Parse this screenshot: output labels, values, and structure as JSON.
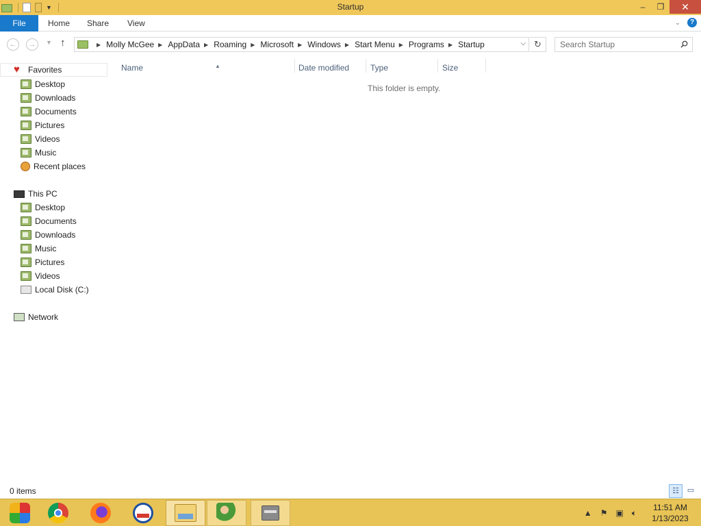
{
  "window": {
    "title": "Startup",
    "controls": {
      "minimize": "–",
      "restore": "❐",
      "close": "✕"
    }
  },
  "ribbon": {
    "tabs": [
      "File",
      "Home",
      "Share",
      "View"
    ]
  },
  "address": {
    "breadcrumbs": [
      "Molly McGee",
      "AppData",
      "Roaming",
      "Microsoft",
      "Windows",
      "Start Menu",
      "Programs",
      "Startup"
    ]
  },
  "search": {
    "placeholder": "Search Startup"
  },
  "nav": {
    "favorites_label": "Favorites",
    "favorites": [
      "Desktop",
      "Downloads",
      "Documents",
      "Pictures",
      "Videos",
      "Music",
      "Recent places"
    ],
    "thispc_label": "This PC",
    "thispc": [
      "Desktop",
      "Documents",
      "Downloads",
      "Music",
      "Pictures",
      "Videos",
      "Local Disk (C:)"
    ],
    "network_label": "Network"
  },
  "columns": [
    "Name",
    "Date modified",
    "Type",
    "Size"
  ],
  "content": {
    "empty_message": "This folder is empty."
  },
  "status": {
    "item_count": "0 items"
  },
  "taskbar": {
    "apps": [
      "app-icon",
      "chrome-icon",
      "firefox-icon",
      "outlook-icon",
      "file-explorer-icon",
      "users-icon",
      "archive-icon"
    ],
    "clock": {
      "time": "11:51 AM",
      "date": "1/13/2023"
    }
  },
  "colors": {
    "titlebar": "#f0c85a",
    "file_tab": "#1979ca",
    "close_button": "#c7503f",
    "taskbar": "#e8c456"
  }
}
